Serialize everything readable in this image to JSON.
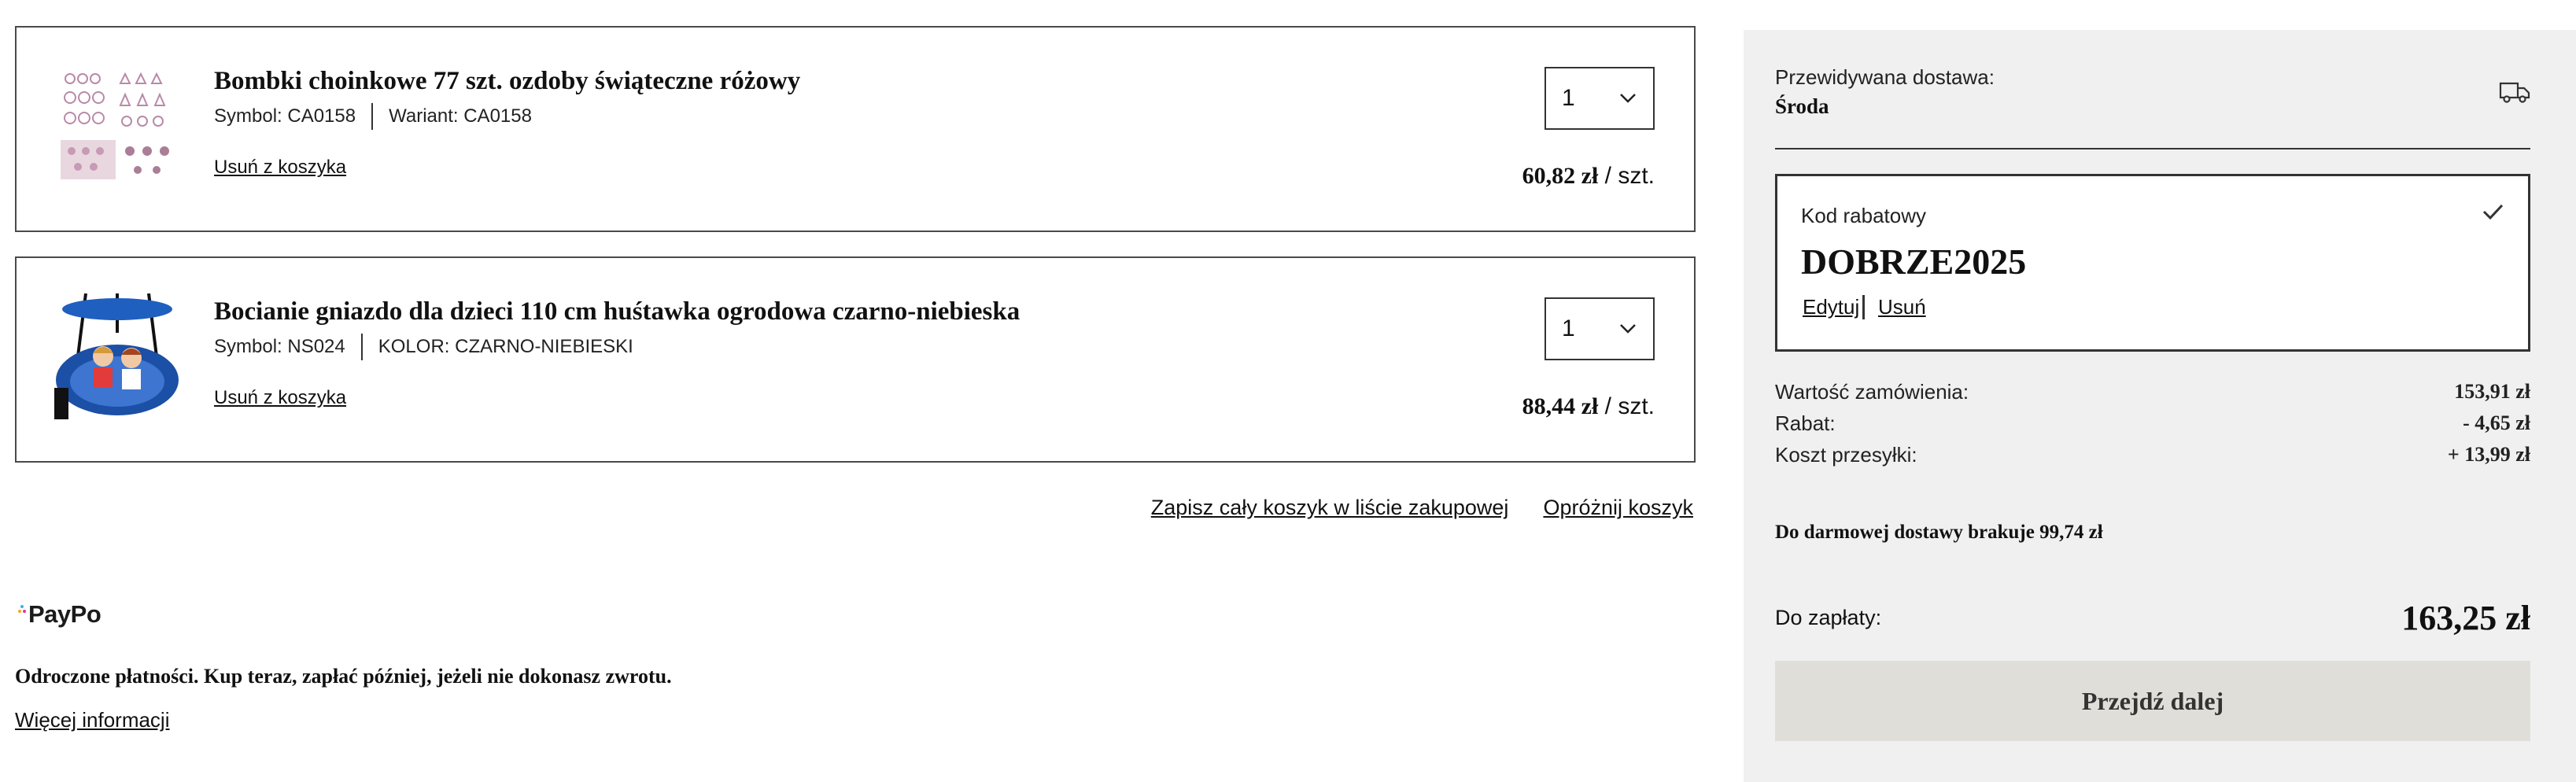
{
  "cart": {
    "items": [
      {
        "name": "Bombki choinkowe 77 szt. ozdoby świąteczne różowy",
        "symbol": "Symbol: CA0158",
        "variant": "Wariant: CA0158",
        "remove_label": "Usuń z koszyka",
        "quantity": "1",
        "price": "60,82 zł",
        "unit": " / szt."
      },
      {
        "name": "Bocianie gniazdo dla dzieci 110 cm huśtawka ogrodowa czarno-niebieska",
        "symbol": "Symbol: NS024",
        "variant": "KOLOR: CZARNO-NIEBIESKI",
        "remove_label": "Usuń z koszyka",
        "quantity": "1",
        "price": "88,44 zł",
        "unit": " / szt."
      }
    ],
    "save_list_label": "Zapisz cały koszyk w liście zakupowej",
    "empty_cart_label": "Opróżnij koszyk"
  },
  "paypo": {
    "logo_text": "PayPo",
    "description": "Odroczone płatności. Kup teraz, zapłać później, jeżeli nie dokonasz zwrotu.",
    "more_label": "Więcej informacji"
  },
  "summary": {
    "delivery_label": "Przewidywana dostawa:",
    "delivery_day": "Środa",
    "coupon_label": "Kod rabatowy",
    "coupon_code": "DOBRZE2025",
    "coupon_edit": "Edytuj",
    "coupon_remove": "Usuń",
    "order_value_label": "Wartość zamówienia:",
    "order_value": "153,91 zł",
    "discount_label": "Rabat:",
    "discount": "- 4,65 zł",
    "shipping_label": "Koszt przesyłki:",
    "shipping": "+ 13,99 zł",
    "free_shipping_info": "Do darmowej dostawy brakuje 99,74 zł",
    "total_label": "Do zapłaty:",
    "total": "163,25 zł",
    "next_button": "Przejdź dalej"
  },
  "icons": {
    "truck": "truck-icon",
    "check": "check-icon",
    "chevron": "chevron-down-icon"
  },
  "colors": {
    "sidebar_bg": "#f0f0f0",
    "button_bg": "#e0ded8"
  }
}
